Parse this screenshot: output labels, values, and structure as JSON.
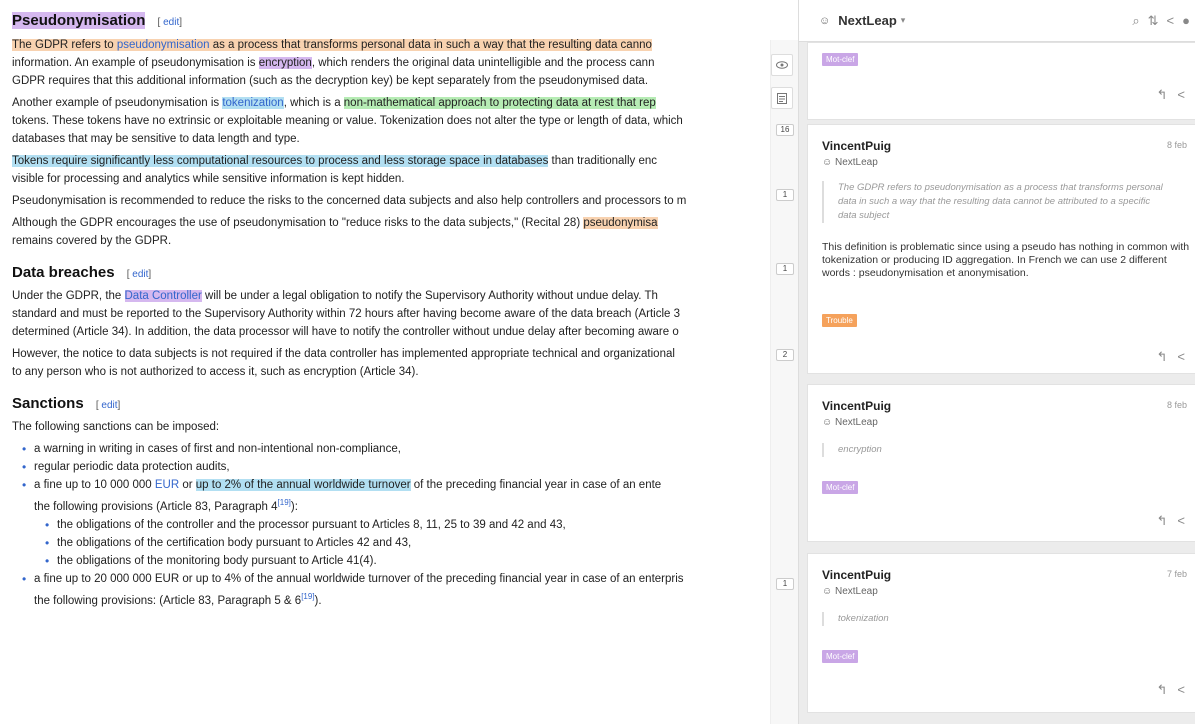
{
  "article": {
    "edit_label": "edit",
    "section1": {
      "title": "Pseudonymisation",
      "p1": {
        "a": "The GDPR refers to ",
        "b": "pseudonymisation",
        "c": " as a process that transforms personal data in such a way that the resulting data canno",
        "line2": "information. An example of pseudonymisation is ",
        "enc": "encryption",
        "line2b": ", which renders the original data unintelligible and the process cann",
        "line3": "GDPR requires that this additional information (such as the decryption key) be kept separately from the pseudonymised data."
      },
      "p2": {
        "a": "Another example of pseudonymisation is ",
        "tok": "tokenization",
        "b": ", which is a ",
        "green": "non-mathematical approach to protecting data at rest that rep",
        "line2": "tokens. These tokens have no extrinsic or exploitable meaning or value. Tokenization does not alter the type or length of data, which",
        "line3": "databases that may be sensitive to data length and type."
      },
      "p3": {
        "blue": "Tokens require significantly less computational resources to process and less storage space in databases",
        "a": " than traditionally enc",
        "line2": "visible for processing and analytics while sensitive information is kept hidden."
      },
      "p4": "Pseudonymisation is recommended to reduce the risks to the concerned data subjects and also help controllers and processors to m",
      "p5": {
        "a": "Although the GDPR encourages the use of pseudonymisation to \"reduce risks to the data subjects,\" (Recital 28) ",
        "orange": "pseudonymisa",
        "line2": "remains covered by the GDPR."
      }
    },
    "section2": {
      "title": "Data breaches",
      "p1": {
        "a": "Under the GDPR, the ",
        "purple": "Data Controller",
        "b": " will be under a legal obligation to notify the Supervisory Authority without undue delay. Th",
        "line2": "standard and must be reported to the Supervisory Authority within 72 hours after having become aware of the data breach (Article 3",
        "line3": "determined (Article 34). In addition, the data processor will have to notify the controller without undue delay after becoming aware o"
      },
      "p2": {
        "line1": "However, the notice to data subjects is not required if the data controller has implemented appropriate technical and organizational",
        "line2": "to any person who is not authorized to access it, such as encryption (Article 34)."
      }
    },
    "section3": {
      "title": "Sanctions",
      "intro": "The following sanctions can be imposed:",
      "items": [
        "a warning in writing in cases of first and non-intentional non-compliance,",
        "regular periodic data protection audits,"
      ],
      "item3": {
        "a": "a fine up to 10 000 000 ",
        "eur": "EUR",
        "b": " or ",
        "blue": "up to 2% of the annual worldwide turnover",
        "c": " of the preceding financial year in case of an ente",
        "line2": "the following provisions (Article 83, Paragraph 4",
        "ref": "[19]",
        "line2b": "):"
      },
      "subitems": [
        "the obligations of the controller and the processor pursuant to Articles 8, 11, 25 to 39 and 42 and 43,",
        "the obligations of the certification body pursuant to Articles 42 and 43,",
        "the obligations of the monitoring body pursuant to Article 41(4)."
      ],
      "item4": {
        "line1": "a fine up to 20 000 000 EUR or up to 4% of the annual worldwide turnover of the preceding financial year in case of an enterpris",
        "line2": "the following provisions: (Article 83, Paragraph 5 & 6",
        "ref": "[19]",
        "line2b": ")."
      }
    },
    "counts": [
      "16",
      "1",
      "1",
      "2",
      "1"
    ]
  },
  "sidebar": {
    "group_name": "NextLeap",
    "top_card": {
      "tag": "Mot-clef"
    },
    "annotations": [
      {
        "user": "VincentPuig",
        "date": "8 feb",
        "group": "NextLeap",
        "quote": "The GDPR refers to pseudonymisation as a process that transforms personal data in such a way that the resulting data cannot be attributed to a specific data subject",
        "body": "This definition is problematic since using a pseudo has nothing in common with tokenization or producing ID aggregation. In French we can use 2 different words : pseudonymisation et anonymisation.",
        "tag": "Trouble"
      },
      {
        "user": "VincentPuig",
        "date": "8 feb",
        "group": "NextLeap",
        "quote": "encryption",
        "tag": "Mot-clef"
      },
      {
        "user": "VincentPuig",
        "date": "7 feb",
        "group": "NextLeap",
        "quote": "tokenization",
        "tag": "Mot-clef"
      }
    ]
  }
}
